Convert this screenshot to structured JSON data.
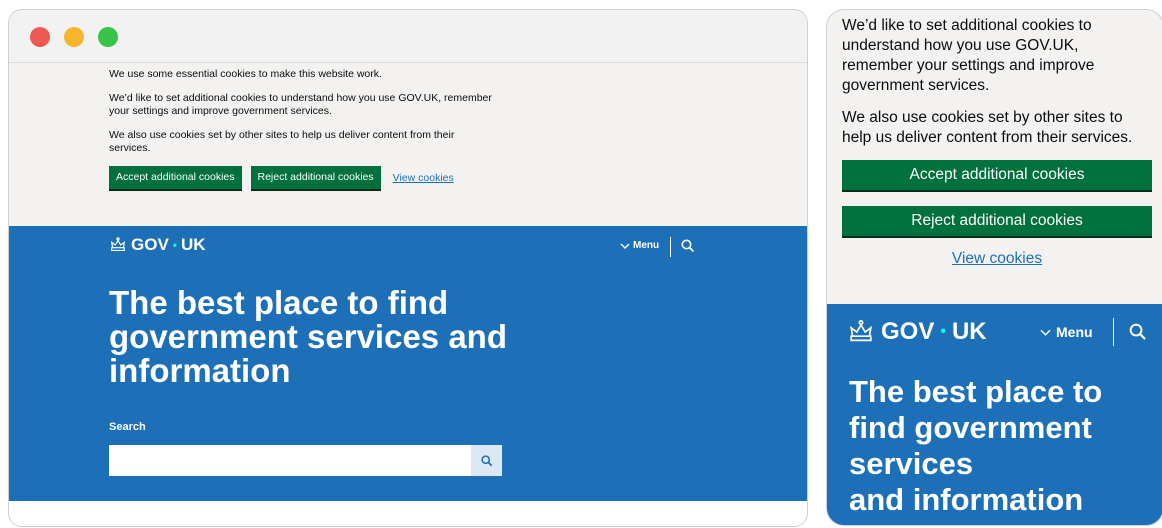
{
  "desktop": {
    "window_controls": [
      "close",
      "minimize",
      "maximize"
    ],
    "cookie_banner": {
      "p1": "We use some essential cookies to make this website work.",
      "p2": "We’d like to set additional cookies to understand how you use GOV.UK, remember your settings and improve government services.",
      "p3": "We also use cookies set by other sites to help us deliver content from their services.",
      "accept_label": "Accept additional cookies",
      "reject_label": "Reject additional cookies",
      "view_label": "View cookies"
    },
    "header": {
      "logo_left": "GOV",
      "logo_dot": "•",
      "logo_right": "UK",
      "menu_label": "Menu",
      "icons": [
        "crown-icon",
        "chevron-down-icon",
        "search-icon"
      ]
    },
    "hero": {
      "title": "The best place to find government services and information",
      "search_label": "Search",
      "search_value": ""
    }
  },
  "mobile": {
    "cookie_banner": {
      "p2": "We’d like to set additional cookies to understand how you use GOV.UK, remember your settings and improve government services.",
      "p3": "We also use cookies set by other sites to help us deliver content from their services.",
      "accept_label": "Accept additional cookies",
      "reject_label": "Reject additional cookies",
      "view_label": "View cookies"
    },
    "header": {
      "logo_left": "GOV",
      "logo_dot": "•",
      "logo_right": "UK",
      "menu_label": "Menu"
    },
    "hero": {
      "title_line1": "The best place to",
      "title_line2": "find government",
      "title_line3": "services",
      "title_line4": "and information"
    }
  },
  "colors": {
    "brand_blue": "#1d70b8",
    "button_green": "#00703c",
    "banner_grey": "#f3f2f1",
    "logo_dot": "#00ffe0"
  }
}
